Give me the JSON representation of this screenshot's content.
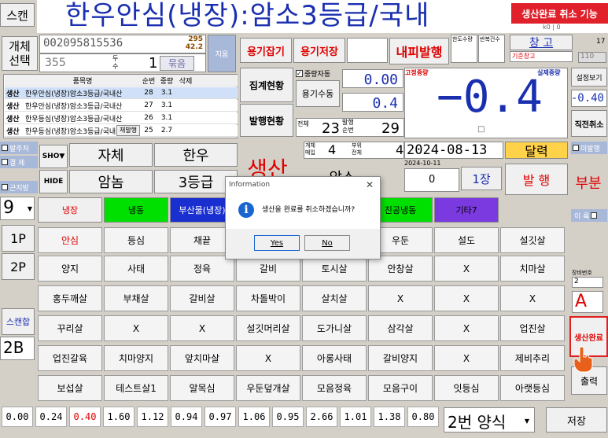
{
  "top": {
    "scan": "스캔",
    "title": "한우안심(냉장):암소3등급/국내",
    "feature_badge": "생산완료 취소 기능"
  },
  "left_panel": {
    "individual_select": "개체\n선택",
    "barcode": "002095815536",
    "num_295": "295",
    "num_42": "42.2",
    "sub_label": "지움",
    "num_355": "355",
    "head_label": "두\n수",
    "num_1": "1",
    "bundle_btn": "묶음"
  },
  "toolbar": {
    "container_hold": "용기잡기",
    "container_save": "용기저장",
    "interior_issue": "내피발행",
    "col_kind_count": "한도수량",
    "col_repeat_count": "반복건수",
    "warehouse": "창  고",
    "warehouse_sub": "기준창고",
    "num_17": "17",
    "num_110": "110",
    "header_snippet": "k0 | 0"
  },
  "table": {
    "headers": [
      "품목명",
      "순번",
      "중량",
      "삭제"
    ],
    "rows": [
      {
        "tag": "생산",
        "name": "한우안심(냉장)암소3등급/국내산",
        "seq": "28",
        "weight": "3.1"
      },
      {
        "tag": "생산",
        "name": "한우안심(냉장)암소3등급/국내산",
        "seq": "27",
        "weight": "3.1"
      },
      {
        "tag": "생산",
        "name": "한우등심(냉장)암소3등급/국내산",
        "seq": "26",
        "weight": "3.1"
      },
      {
        "tag": "생산",
        "name": "한우등심(냉장)암소3등급/국내",
        "seq": "25",
        "weight": "2.7"
      }
    ],
    "reissue_btn": "재발행"
  },
  "middle": {
    "summary": "집계현황",
    "issue_status": "발행현황",
    "check_tare": "중량자동",
    "container_count": "용기수동",
    "tare_value": "0.00",
    "value_04": "0.4",
    "total_label": "전체",
    "total_23": "23",
    "issue_label": "발행\n순번",
    "seq_29": "29",
    "count_label": "개체\n매입",
    "count_4": "4",
    "part_label": "부위\n전체",
    "part_4": "4",
    "date_main": "2024-08-13",
    "date_sub": "2024-10-11",
    "zero": "0",
    "sheets": "1장",
    "calendar_btn": "달력",
    "issue_btn": "발  행"
  },
  "weight": {
    "fixed_label": "고정중량",
    "actual_label": "실제중량",
    "display": "−0.4",
    "small_box": "□"
  },
  "right_panel": {
    "settings": "설정보기",
    "neg_value": "-0.40",
    "direct_cancel": "직전취소",
    "unissued": "미발행",
    "part_btn": "부분",
    "ee_btn": "이 륙",
    "equip_label": "장비번호",
    "equip_num": "2",
    "grade_a": "A",
    "complete": "생산완료",
    "print": "출력"
  },
  "left_controls": {
    "auto_scale": "발주처",
    "pay_check": "결 제",
    "show_label": "SHO▼",
    "hide_label": "HIDE",
    "entire": "자체",
    "hanwoo": "한우",
    "cow": "암놈",
    "grade3": "3등급",
    "production": "생산",
    "sort": "암소",
    "region_check": "근지방",
    "combo_9": "9",
    "page1": "1P",
    "page2": "2P",
    "scan_merge": "스캔합",
    "combo_2b": "2B"
  },
  "categories": [
    {
      "label": "냉장",
      "color": "#f0f0f0",
      "text_color": "#e00000"
    },
    {
      "label": "냉동",
      "color": "#00e000",
      "text_color": "#000"
    },
    {
      "label": "부산물(냉장)",
      "color": "#1a2fd0",
      "text_color": "#fff"
    },
    {
      "label": "진공냉동",
      "color": "#00e000",
      "text_color": "#000"
    },
    {
      "label": "기타7",
      "color": "#7a3ae0",
      "text_color": "#000"
    }
  ],
  "items": [
    [
      "안심",
      "등심",
      "채끝",
      "",
      "",
      "우둔",
      "설도",
      "설깃살"
    ],
    [
      "양지",
      "사태",
      "정육",
      "갈비",
      "토시살",
      "안창살",
      "X",
      "치마살"
    ],
    [
      "홍두깨살",
      "부채살",
      "갈비살",
      "차돌박이",
      "살치살",
      "X",
      "X",
      "X"
    ],
    [
      "꾸리살",
      "X",
      "X",
      "설깃머리살",
      "도가니살",
      "삼각살",
      "X",
      "업진살"
    ],
    [
      "업진갈육",
      "치마양지",
      "앞치마살",
      "X",
      "아롱사태",
      "갈비양지",
      "X",
      "제비추리"
    ],
    [
      "보섭살",
      "테스트살1",
      "알목심",
      "우둔덮개살",
      "모음정육",
      "모음구이",
      "잇등심",
      "아랫등심"
    ]
  ],
  "bottom": {
    "weights": [
      "0.00",
      "0.24",
      "0.40",
      "1.60",
      "1.12",
      "0.94",
      "0.97",
      "1.06",
      "0.95",
      "2.66",
      "1.01",
      "1.38",
      "0.80"
    ],
    "format": "2번 양식",
    "save": "저장"
  },
  "dialog": {
    "title": "Information",
    "message": "생산을 완료를 취소하겠습니까?",
    "yes": "Yes",
    "no": "No"
  }
}
